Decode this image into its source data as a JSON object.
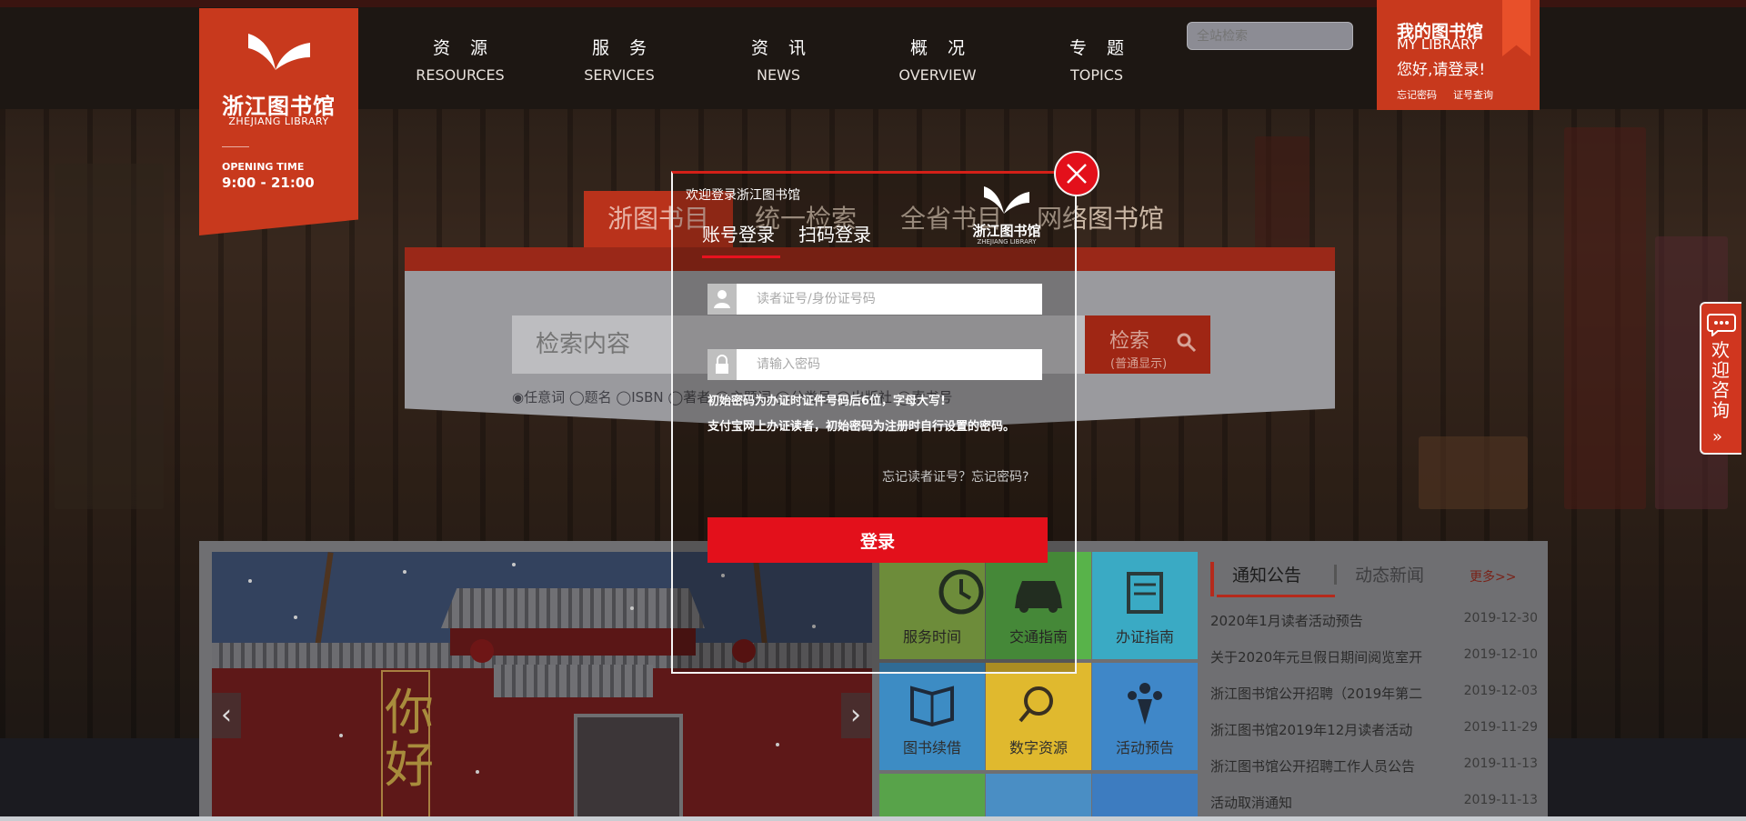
{
  "header": {
    "logo": {
      "name_cn": "浙江图书馆",
      "name_en": "ZHEJIANG LIBRARY",
      "opening_label": "OPENING TIME",
      "opening_hours": "9:00 - 21:00"
    },
    "nav": [
      {
        "cn": "资源",
        "en": "RESOURCES"
      },
      {
        "cn": "服务",
        "en": "SERVICES"
      },
      {
        "cn": "资讯",
        "en": "NEWS"
      },
      {
        "cn": "概况",
        "en": "OVERVIEW"
      },
      {
        "cn": "专题",
        "en": "TOPICS"
      }
    ],
    "site_search_placeholder": "全站检索",
    "my_library": {
      "title": "我的图书馆",
      "subtitle": "MY LIBRARY",
      "greeting": "您好,请登录!",
      "forgot_password": "忘记密码",
      "card_query": "证号查询"
    }
  },
  "search": {
    "tabs": [
      "浙图书目",
      "统一检索",
      "全省书目",
      "网络图书馆"
    ],
    "active_tab": 0,
    "input_placeholder": "检索内容",
    "button_label": "检索",
    "button_hint": "(普通显示)",
    "options_text": "◉任意词 ◯题名 ◯ISBN ◯著者 ◯主题词 ◯分类号 ◯出版社 ◯索书号"
  },
  "tiles": [
    {
      "label": "服务时间",
      "icon": "clock-icon",
      "color": "#8eb84c"
    },
    {
      "label": "交通指南",
      "icon": "car-icon",
      "color": "#58b34a"
    },
    {
      "label": "办证指南",
      "icon": "card-icon",
      "color": "#3aaac4"
    },
    {
      "label": "图书续借",
      "icon": "book-icon",
      "color": "#3d8cc4"
    },
    {
      "label": "数字资源",
      "icon": "globe-icon",
      "color": "#e0b92e"
    },
    {
      "label": "活动预告",
      "icon": "people-icon",
      "color": "#3f87c8"
    }
  ],
  "notices": {
    "tab_active": "通知公告",
    "tab_inactive": "动态新闻",
    "more": "更多>>",
    "items": [
      {
        "title": "2020年1月读者活动预告",
        "date": "2019-12-30"
      },
      {
        "title": "关于2020年元旦假日期间阅览室开",
        "date": "2019-12-10"
      },
      {
        "title": "浙江图书馆公开招聘（2019年第二",
        "date": "2019-12-03"
      },
      {
        "title": "浙江图书馆2019年12月读者活动",
        "date": "2019-11-29"
      },
      {
        "title": "浙江图书馆公开招聘工作人员公告",
        "date": "2019-11-13"
      },
      {
        "title": "活动取消通知",
        "date": "2019-11-13"
      }
    ]
  },
  "consult": {
    "label": "欢迎咨询"
  },
  "login_modal": {
    "welcome": "欢迎登录浙江图书馆",
    "tab_account": "账号登录",
    "tab_qr": "扫码登录",
    "logo_cn": "浙江图书馆",
    "logo_en": "ZHEJIANG LIBRARY",
    "username_placeholder": "读者证号/身份证号码",
    "password_placeholder": "请输入密码",
    "note1": "初始密码为办证时证件号码后6位，字母大写!",
    "note2": "支付宝网上办证读者，初始密码为注册时自行设置的密码。",
    "forgot": "忘记读者证号？忘记密码?",
    "login_button": "登录"
  },
  "colors": {
    "brand_red": "#c8391d",
    "login_red": "#e3101b"
  }
}
